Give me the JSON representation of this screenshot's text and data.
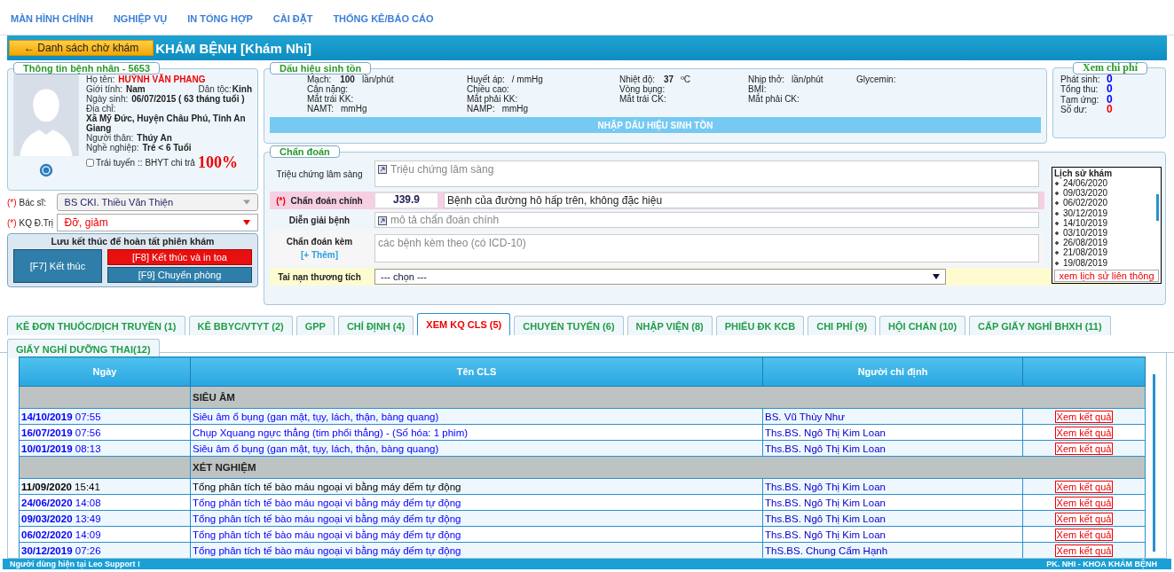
{
  "nav": [
    "MÀN HÌNH CHÍNH",
    "NGHIỆP VỤ",
    "IN TỔNG HỢP",
    "CÀI ĐẶT",
    "THỐNG KÊ/BÁO CÁO"
  ],
  "header": {
    "back_button": "← Danh sách chờ khám",
    "title": "KHÁM BỆNH [Khám Nhi]"
  },
  "patient": {
    "legend": "Thông tin bệnh nhân - 5653",
    "name_label": "Họ tên:",
    "name": "HUỲNH VĂN PHANG",
    "gender_label": "Giới tính:",
    "gender": "Nam",
    "ethnic_label": "Dân tộc:",
    "ethnic": "Kinh",
    "dob_label": "Ngày sinh:",
    "dob": "06/07/2015 ( 63 tháng tuổi )",
    "address_label": "Địa chỉ:",
    "address": "Xã Mỹ Đức, Huyện Châu Phú, Tỉnh An Giang",
    "relative_label": "Người thân:",
    "relative": "Thúy An",
    "job_label": "Nghề nghiệp:",
    "job": "Trẻ < 6 Tuổi",
    "off_route": {
      "label": "Trái tuyến",
      "checked": false
    },
    "insurance_label": ":: BHYT chi trả",
    "insurance_pct": "100%"
  },
  "doctor": {
    "required": "(*)",
    "label": "Bác sĩ:",
    "value": "BS CKI. Thiều Văn Thiện"
  },
  "result": {
    "required": "(*)",
    "label": "KQ Đ.Trị",
    "value": "Đỡ, giảm"
  },
  "finish": {
    "title": "Lưu kết thúc để hoàn tất phiên khám",
    "buttons": [
      {
        "label": "[F7] Kết thúc",
        "kind": "main"
      },
      {
        "label": "[F8] Kết thúc và in toa",
        "kind": "danger"
      },
      {
        "label": "[F9] Chuyển phòng",
        "kind": "secondary"
      }
    ]
  },
  "vitals": {
    "legend": "Dấu hiệu sinh tồn",
    "rows": [
      [
        {
          "label": "Mạch:",
          "value": "100",
          "unit": "lần/phút"
        },
        {
          "label": "Huyết áp:",
          "unit": "/ mmHg"
        },
        {
          "label": "Nhiệt độ:",
          "value": "37",
          "unit": "ºC"
        },
        {
          "label": "Nhịp thở:",
          "unit": "lần/phút"
        },
        {
          "label": "Glycemin:"
        }
      ],
      [
        {
          "label": "Cân nặng:"
        },
        {
          "label": "Chiều cao:"
        },
        {
          "label": "Vòng bụng:"
        },
        {
          "label": "BMI:"
        }
      ],
      [
        {
          "label": "Mắt trái KK:"
        },
        {
          "label": "Mắt phải KK:"
        },
        {
          "label": "Mắt trái CK:"
        },
        {
          "label": "Mắt phải CK:"
        }
      ],
      [
        {
          "label": "NAMT:",
          "unit": "mmHg"
        },
        {
          "label": "NAMP:",
          "unit": "mmHg"
        }
      ]
    ],
    "button": "NHẬP DẤU HIỆU SINH TỒN"
  },
  "costs": {
    "legend": "Xem chi phí",
    "items": [
      {
        "label": "Phát sinh:",
        "value": "0",
        "color": "#0000ff"
      },
      {
        "label": "Tổng thu:",
        "value": "0",
        "color": "#0000ff"
      },
      {
        "label": "Tạm ứng:",
        "value": "0",
        "color": "#0000ff"
      },
      {
        "label": "Số dư:",
        "value": "0",
        "color": "#ff0000"
      }
    ]
  },
  "diagnosis": {
    "legend": "Chẩn đoán",
    "symptoms": {
      "label": "Triệu chứng lâm sàng",
      "placeholder": "Triệu chứng lâm sàng"
    },
    "main": {
      "required": "(*)",
      "label": "Chẩn đoán chính",
      "code": "J39.9",
      "value": "Bệnh của đường hô hấp trên, không đặc hiệu"
    },
    "explain": {
      "label": "Diễn giải bệnh",
      "placeholder": "mô tả chẩn đoán chính"
    },
    "extra": {
      "label": "Chẩn đoán kèm",
      "add": "[+ Thêm]",
      "placeholder": "các bệnh kèm theo (có ICD-10)"
    },
    "accident": {
      "label": "Tai nạn thương tích",
      "value": "--- chọn ---"
    }
  },
  "history": {
    "title": "Lịch sử khám",
    "dates": [
      "24/06/2020",
      "09/03/2020",
      "06/02/2020",
      "30/12/2019",
      "14/10/2019",
      "03/10/2019",
      "26/08/2019",
      "21/08/2019",
      "19/08/2019"
    ],
    "link": "xem lịch sử liên thông"
  },
  "tabs": [
    {
      "label": "KÊ ĐƠN THUỐC/DỊCH TRUYỀN (1)",
      "selected": false
    },
    {
      "label": "KÊ BBYC/VTYT (2)",
      "selected": false
    },
    {
      "label": "GPP",
      "selected": false
    },
    {
      "label": "CHỈ ĐỊNH (4)",
      "selected": false
    },
    {
      "label": "XEM KQ CLS (5)",
      "selected": true
    },
    {
      "label": "CHUYỂN TUYẾN (6)",
      "selected": false
    },
    {
      "label": "NHẬP VIỆN (8)",
      "selected": false
    },
    {
      "label": "PHIẾU ĐK KCB",
      "selected": false
    },
    {
      "label": "CHI PHÍ (9)",
      "selected": false
    },
    {
      "label": "HỘI CHẨN (10)",
      "selected": false
    },
    {
      "label": "CẤP GIẤY NGHỈ BHXH (11)",
      "selected": false
    },
    {
      "label": "GIẤY NGHỈ DƯỠNG THAI(12)",
      "selected": false
    }
  ],
  "table": {
    "columns": [
      "Ngày",
      "Tên CLS",
      "Người chỉ định"
    ],
    "groups": [
      {
        "title": "SIÊU ÂM",
        "rows": [
          {
            "date": "14/10/2019",
            "time": "07:55",
            "name": "Siêu âm ổ bụng (gan mật, tụy, lách, thận, bàng quang)",
            "doctor": "BS. Vũ Thùy Như",
            "action": "Xem kết quả",
            "color": "#0000ff"
          },
          {
            "date": "16/07/2019",
            "time": "07:56",
            "name": "Chụp Xquang ngực thẳng (tim phổi thẳng) - (Số hóa: 1 phim)",
            "doctor": "Ths.BS. Ngô Thị Kim Loan",
            "action": "Xem kết quả",
            "color": "#0000ff"
          },
          {
            "date": "10/01/2019",
            "time": "08:13",
            "name": "Siêu âm ổ bụng (gan mật, tụy, lách, thận, bàng quang)",
            "doctor": "Ths.BS. Ngô Thị Kim Loan",
            "action": "Xem kết quả",
            "color": "#0000ff"
          }
        ]
      },
      {
        "title": "XÉT NGHIỆM",
        "rows": [
          {
            "date": "11/09/2020",
            "time": "15:41",
            "name": "Tổng phân tích tế bào máu ngoại vi bằng máy đếm tự động",
            "doctor": "Ths.BS. Ngô Thị Kim Loan",
            "action": "Xem kết quả",
            "color": "#000000"
          },
          {
            "date": "24/06/2020",
            "time": "14:08",
            "name": "Tổng phân tích tế bào máu ngoại vi bằng máy đếm tự động",
            "doctor": "Ths.BS. Ngô Thị Kim Loan",
            "action": "Xem kết quả",
            "color": "#0000ff"
          },
          {
            "date": "09/03/2020",
            "time": "13:49",
            "name": "Tổng phân tích tế bào máu ngoại vi bằng máy đếm tự động",
            "doctor": "Ths.BS. Ngô Thị Kim Loan",
            "action": "Xem kết quả",
            "color": "#0000ff"
          },
          {
            "date": "06/02/2020",
            "time": "14:09",
            "name": "Tổng phân tích tế bào máu ngoại vi bằng máy đếm tự động",
            "doctor": "Ths.BS. Ngô Thị Kim Loan",
            "action": "Xem kết quả",
            "color": "#0000ff"
          },
          {
            "date": "30/12/2019",
            "time": "07:26",
            "name": "Tổng phân tích tế bào máu ngoại vi bằng máy đếm tự động",
            "doctor": "ThS.BS. Chung Cẩm Hạnh",
            "action": "Xem kết quả",
            "color": "#0000ff"
          }
        ]
      }
    ]
  },
  "status_bar": {
    "left": "Người dùng hiện tại Leo Support !",
    "right": "PK. NHI - KHOA KHÁM BỆNH"
  }
}
